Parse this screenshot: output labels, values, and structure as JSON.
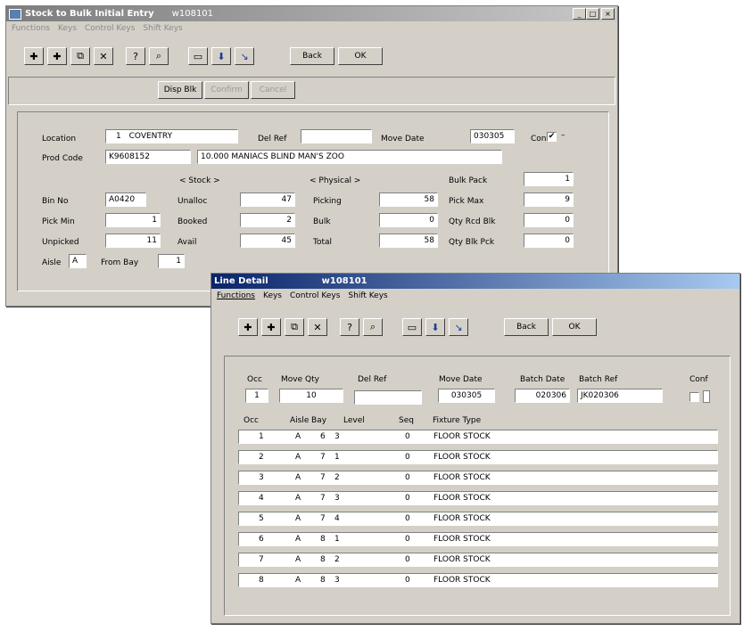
{
  "main": {
    "title": "Stock to Bulk Initial Entry",
    "code": "w108101",
    "menu": [
      "Functions",
      "Keys",
      "Control Keys",
      "Shift Keys"
    ],
    "toolbar": {
      "back": "Back",
      "ok": "OK"
    },
    "actions": {
      "disp_blk": "Disp Blk",
      "confirm": "Confirm",
      "cancel": "Cancel"
    },
    "form": {
      "location_label": "Location",
      "location_code": "1",
      "location_name": "COVENTRY",
      "del_ref_label": "Del Ref",
      "del_ref": "",
      "move_date_label": "Move Date",
      "move_date": "030305",
      "conf_label": "Conf",
      "conf_mark": "✔",
      "conf_dash": "–",
      "prod_code_label": "Prod Code",
      "prod_code": "K9608152",
      "prod_desc": "10.000 MANIACS BLIND MAN'S ZOO",
      "stock_hdr": "<  Stock  >",
      "physical_hdr": "<  Physical  >",
      "bin_no_label": "Bin No",
      "bin_no": "A0420",
      "unalloc_label": "Unalloc",
      "unalloc": "47",
      "picking_label": "Picking",
      "picking": "58",
      "bulk_pack_label": "Bulk Pack",
      "bulk_pack": "1",
      "pick_min_label": "Pick Min",
      "pick_min": "1",
      "booked_label": "Booked",
      "booked": "2",
      "bulk_label": "Bulk",
      "bulk": "0",
      "pick_max_label": "Pick Max",
      "pick_max": "9",
      "unpicked_label": "Unpicked",
      "unpicked": "11",
      "avail_label": "Avail",
      "avail": "45",
      "total_label": "Total",
      "total": "58",
      "qty_rcd_blk_label": "Qty Rcd Blk",
      "qty_rcd_blk": "0",
      "qty_blk_pck_label": "Qty Blk Pck",
      "qty_blk_pck": "0",
      "aisle_label": "Aisle",
      "aisle": "A",
      "from_bay_label": "From Bay",
      "from_bay": "1"
    }
  },
  "detail": {
    "title": "Line Detail",
    "code": "w108101",
    "menu": [
      "Functions",
      "Keys",
      "Control Keys",
      "Shift Keys"
    ],
    "toolbar": {
      "back": "Back",
      "ok": "OK"
    },
    "header": {
      "occ_label": "Occ",
      "occ": "1",
      "move_qty_label": "Move Qty",
      "move_qty": "10",
      "del_ref_label": "Del Ref",
      "del_ref": "",
      "move_date_label": "Move Date",
      "move_date": "030305",
      "batch_date_label": "Batch Date",
      "batch_date": "020306",
      "batch_ref_label": "Batch Ref",
      "batch_ref": "JK020306",
      "conf_label": "Conf"
    },
    "columns": {
      "occ": "Occ",
      "aisle": "Aisle",
      "bay": "Bay",
      "level": "Level",
      "seq": "Seq",
      "fixture": "Fixture Type"
    },
    "rows": [
      {
        "occ": "1",
        "aisle": "A",
        "bay": "6",
        "level": "3",
        "seq": "0",
        "fixture": "FLOOR STOCK"
      },
      {
        "occ": "2",
        "aisle": "A",
        "bay": "7",
        "level": "1",
        "seq": "0",
        "fixture": "FLOOR STOCK"
      },
      {
        "occ": "3",
        "aisle": "A",
        "bay": "7",
        "level": "2",
        "seq": "0",
        "fixture": "FLOOR STOCK"
      },
      {
        "occ": "4",
        "aisle": "A",
        "bay": "7",
        "level": "3",
        "seq": "0",
        "fixture": "FLOOR STOCK"
      },
      {
        "occ": "5",
        "aisle": "A",
        "bay": "7",
        "level": "4",
        "seq": "0",
        "fixture": "FLOOR STOCK"
      },
      {
        "occ": "6",
        "aisle": "A",
        "bay": "8",
        "level": "1",
        "seq": "0",
        "fixture": "FLOOR STOCK"
      },
      {
        "occ": "7",
        "aisle": "A",
        "bay": "8",
        "level": "2",
        "seq": "0",
        "fixture": "FLOOR STOCK"
      },
      {
        "occ": "8",
        "aisle": "A",
        "bay": "8",
        "level": "3",
        "seq": "0",
        "fixture": "FLOOR STOCK"
      }
    ]
  },
  "icons": [
    "add-icon",
    "insert-icon",
    "copy-icon",
    "delete-icon",
    "help-icon",
    "find-icon",
    "window-icon",
    "next-icon",
    "jump-icon"
  ],
  "colors": {
    "main_titlebar": "#a9a9a9",
    "detail_titlebar": "#0a246a",
    "face": "#d4d0c8"
  }
}
